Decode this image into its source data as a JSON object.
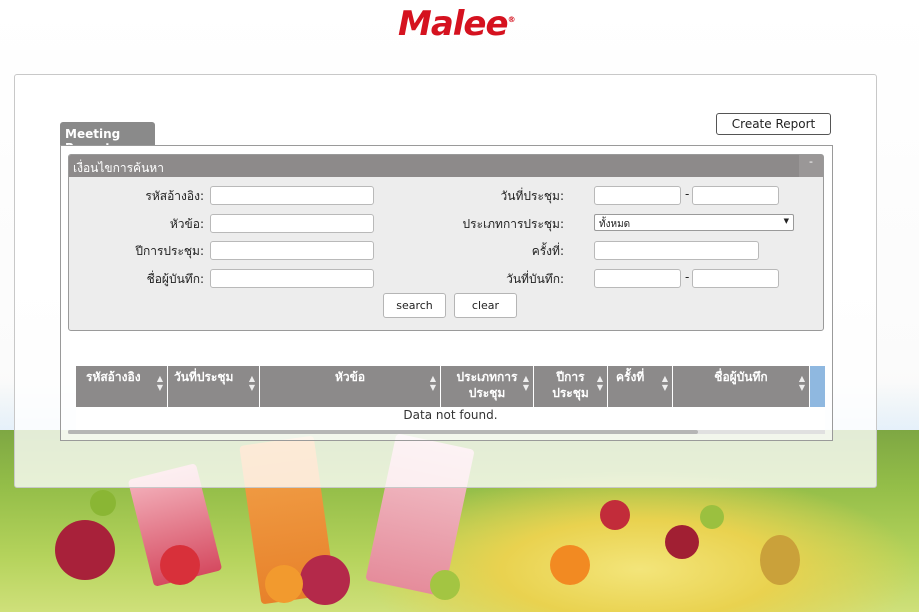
{
  "brand": {
    "logo_text": "Malee",
    "logo_mark": "®",
    "color": "#d5121f"
  },
  "toolbar": {
    "create_report_label": "Create Report"
  },
  "tab": {
    "label": "Meeting Report"
  },
  "search": {
    "header": "เงื่อนไขการค้นหา",
    "collapse_label": "-",
    "fields": {
      "ref_id": {
        "label": "รหัสอ้างอิง:",
        "value": ""
      },
      "subject": {
        "label": "หัวข้อ:",
        "value": ""
      },
      "meeting_year": {
        "label": "ปีการประชุม:",
        "value": ""
      },
      "recorder": {
        "label": "ชื่อผู้บันทึก:",
        "value": ""
      },
      "meeting_date": {
        "label": "วันที่ประชุม:",
        "from": "",
        "to": "",
        "separator": "-"
      },
      "meeting_type": {
        "label": "ประเภทการประชุม:",
        "selected": "ทั้งหมด"
      },
      "session": {
        "label": "ครั้งที่:",
        "value": ""
      },
      "record_date": {
        "label": "วันที่บันทึก:",
        "from": "",
        "to": "",
        "separator": "-"
      }
    },
    "search_label": "search",
    "clear_label": "clear"
  },
  "grid": {
    "columns": [
      {
        "label": "รหัสอ้างอิง"
      },
      {
        "label": "วันที่ประชุม"
      },
      {
        "label": "หัวข้อ"
      },
      {
        "label_line1": "ประเภทการ",
        "label_line2": "ประชุม"
      },
      {
        "label_line1": "ปีการ",
        "label_line2": "ประชุม"
      },
      {
        "label": "ครั้งที่"
      },
      {
        "label": "ชื่อผู้บันทึก"
      }
    ],
    "empty_message": "Data not found."
  }
}
